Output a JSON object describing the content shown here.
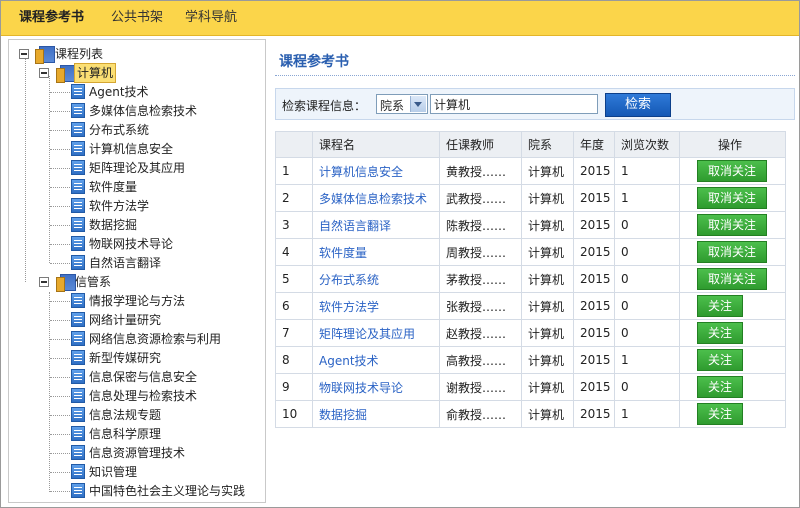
{
  "nav": {
    "items": [
      {
        "label": "课程参考书",
        "active": true
      },
      {
        "label": "公共书架",
        "active": false
      },
      {
        "label": "学科导航",
        "active": false
      }
    ]
  },
  "tree": {
    "root_label": "课程列表",
    "departments": [
      {
        "label": "计算机",
        "selected": true,
        "courses": [
          "Agent技术",
          "多媒体信息检索技术",
          "分布式系统",
          "计算机信息安全",
          "矩阵理论及其应用",
          "软件度量",
          "软件方法学",
          "数据挖掘",
          "物联网技术导论",
          "自然语言翻译"
        ]
      },
      {
        "label": "信管系",
        "selected": false,
        "courses": [
          "情报学理论与方法",
          "网络计量研究",
          "网络信息资源检索与利用",
          "新型传媒研究",
          "信息保密与信息安全",
          "信息处理与检索技术",
          "信息法规专题",
          "信息科学原理",
          "信息资源管理技术",
          "知识管理",
          "中国特色社会主义理论与实践"
        ]
      }
    ]
  },
  "main": {
    "title": "课程参考书",
    "search": {
      "label": "检索课程信息：",
      "field_value": "院系",
      "query": "计算机",
      "button": "检索"
    },
    "table": {
      "headers": [
        "",
        "课程名",
        "任课教师",
        "院系",
        "年度",
        "浏览次数",
        "操作"
      ],
      "rows": [
        {
          "no": "1",
          "course": "计算机信息安全",
          "teacher": "黄教授……",
          "dept": "计算机",
          "year": "2015",
          "views": "1",
          "action": "取消关注"
        },
        {
          "no": "2",
          "course": "多媒体信息检索技术",
          "teacher": "武教授……",
          "dept": "计算机",
          "year": "2015",
          "views": "1",
          "action": "取消关注"
        },
        {
          "no": "3",
          "course": "自然语言翻译",
          "teacher": "陈教授……",
          "dept": "计算机",
          "year": "2015",
          "views": "0",
          "action": "取消关注"
        },
        {
          "no": "4",
          "course": "软件度量",
          "teacher": "周教授……",
          "dept": "计算机",
          "year": "2015",
          "views": "0",
          "action": "取消关注"
        },
        {
          "no": "5",
          "course": "分布式系统",
          "teacher": "茅教授……",
          "dept": "计算机",
          "year": "2015",
          "views": "0",
          "action": "取消关注"
        },
        {
          "no": "6",
          "course": "软件方法学",
          "teacher": "张教授……",
          "dept": "计算机",
          "year": "2015",
          "views": "0",
          "action": "关注"
        },
        {
          "no": "7",
          "course": "矩阵理论及其应用",
          "teacher": "赵教授……",
          "dept": "计算机",
          "year": "2015",
          "views": "0",
          "action": "关注"
        },
        {
          "no": "8",
          "course": "Agent技术",
          "teacher": "高教授……",
          "dept": "计算机",
          "year": "2015",
          "views": "1",
          "action": "关注"
        },
        {
          "no": "9",
          "course": "物联网技术导论",
          "teacher": "谢教授……",
          "dept": "计算机",
          "year": "2015",
          "views": "0",
          "action": "关注"
        },
        {
          "no": "10",
          "course": "数据挖掘",
          "teacher": "俞教授……",
          "dept": "计算机",
          "year": "2015",
          "views": "1",
          "action": "关注"
        }
      ]
    }
  },
  "colors": {
    "nav_bg": "#fbd54a",
    "title_blue": "#2a5fb0",
    "link_blue": "#2b63c5",
    "action_green": "#3aa63a",
    "search_button_blue": "#1c63c4"
  }
}
